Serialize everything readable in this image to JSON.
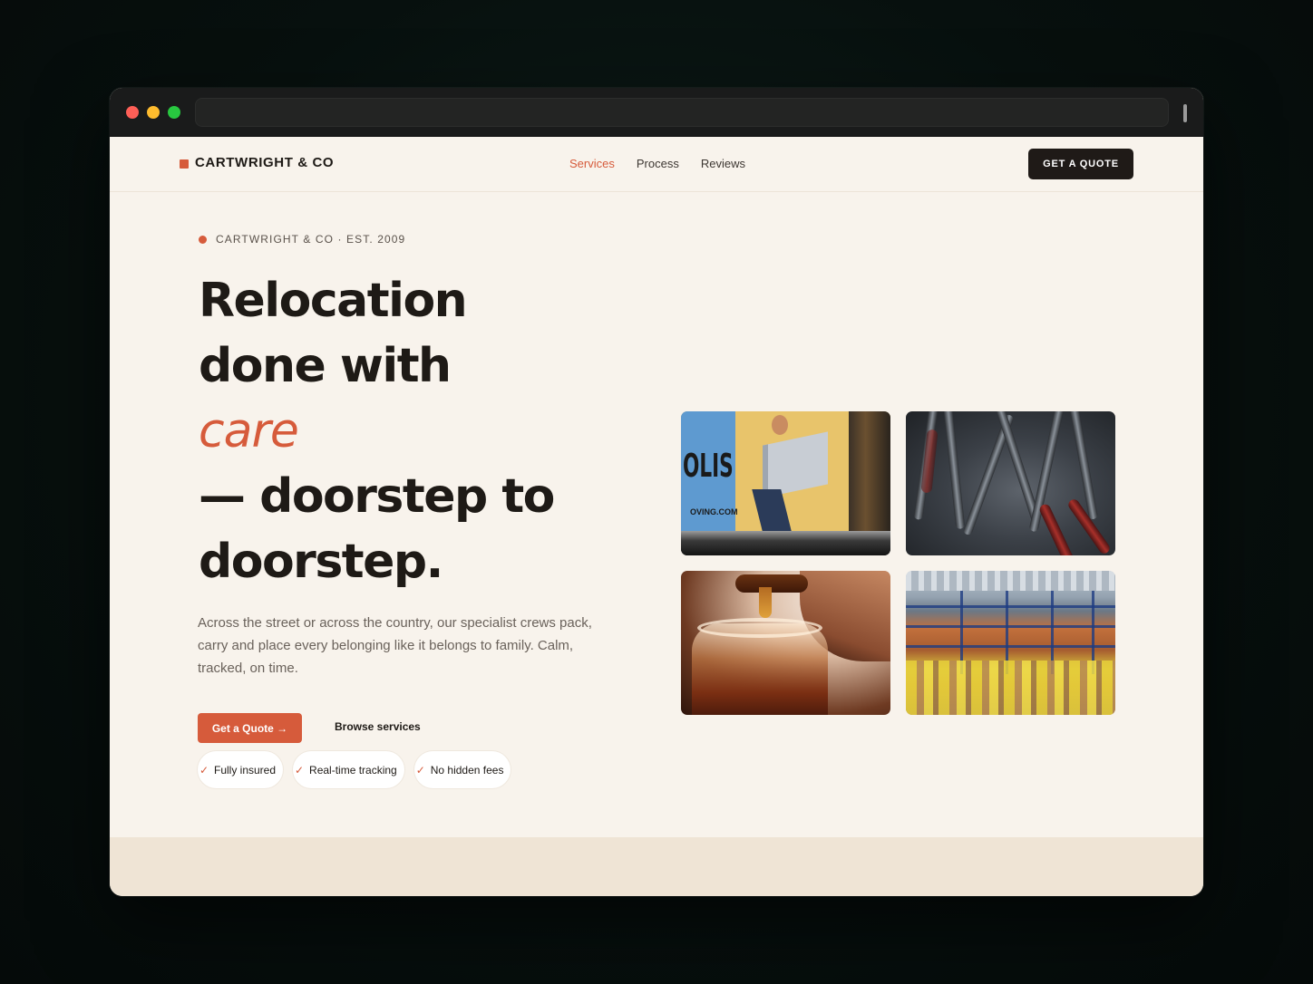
{
  "nav": {
    "brand": "CARTWRIGHT & CO",
    "links": [
      {
        "label": "Services",
        "active": true
      },
      {
        "label": "Process",
        "active": false
      },
      {
        "label": "Reviews",
        "active": false
      }
    ],
    "cta_label": "GET A QUOTE"
  },
  "hero": {
    "eyebrow": "CARTWRIGHT & CO · EST. 2009",
    "headline": {
      "line1": "Relocation",
      "line2": "done with",
      "accent": "care",
      "line3": "— doorstep to",
      "line4": "doorstep."
    },
    "lede": "Across the street or across the country, our specialist crews pack, carry and place every belonging like it belongs to family. Calm, tracked, on time.",
    "primary_cta": "Get a Quote →",
    "secondary_cta": "Browse services",
    "chips": [
      "Fully insured",
      "Real-time tracking",
      "No hidden fees"
    ],
    "chip_icon": "✓"
  },
  "gallery": {
    "tiles": [
      "moving-truck-photo",
      "tools-photo",
      "honey-jar-photo",
      "warehouse-photo"
    ],
    "truck_text": "OLIS",
    "truck_site": "OVING.COM"
  },
  "colors": {
    "accent": "#d65b3b",
    "ink": "#1e1a16",
    "page_bg": "#f8f3ec",
    "band_bg": "#efe4d5"
  }
}
